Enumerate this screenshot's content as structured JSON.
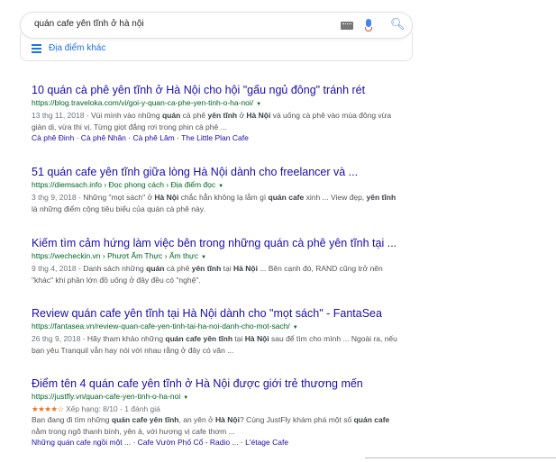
{
  "search": {
    "query": "quán cafe yên tĩnh ở hà nội"
  },
  "places": {
    "label": "Địa điểm khác"
  },
  "results": [
    {
      "title": "10 quán cà phê yên tĩnh ở Hà Nội cho hội \"gấu ngủ đông\" tránh rét",
      "url": "https://blog.traveloka.com/vi/goi-y-quan-ca-phe-yen-tinh-o-ha-noi/",
      "date": "13 thg 11, 2018 - ",
      "snippet_html": "Vùi mình vào những <b>quán</b> cà phê <b>yên tĩnh</b> ở <b>Hà Nội</b> và uống cà phê vào mùa đông vừa giản dị, vừa thi vị. Từng giọt đắng rơi trong phin cà phê ...",
      "links": "Cà phê Đinh · Cà phê Nhân · Cà phê Lâm · The Little Plan Cafe"
    },
    {
      "title": "51 quán cafe yên tĩnh giữa lòng Hà Nội dành cho freelancer và ...",
      "url": "https://diemsach.info › Đọc phong cách › Địa điểm đọc",
      "date": "3 thg 9, 2018 - ",
      "snippet_html": "Những \"mọt sách\" ở <b>Hà Nội</b> chắc hẳn không lạ lẫm gì <b>quán cafe</b> xinh ... View đẹp, <b>yên tĩnh</b> là những điểm cộng tiêu biểu của quán cà phê này."
    },
    {
      "title": "Kiếm tìm cảm hứng làm việc bên trong những quán cà phê yên tĩnh tại ...",
      "url": "https://wecheckin.vn › Phượt Ẩm Thực › Ẩm thực",
      "date": "9 thg 4, 2018 - ",
      "snippet_html": "Danh sách những <b>quán</b> cà phê <b>yên tĩnh</b> tại <b>Hà Nội</b> ... Bên cạnh đó, RAND cũng trở nên \"khác\" khi phần lớn đồ uống ở đây đều có \"nghệ\"."
    },
    {
      "title": "Review quán cafe yên tĩnh tại Hà Nội dành cho \"mọt sách\" - FantaSea",
      "url": "https://fantasea.vn/review-quan-cafe-yen-tinh-tai-ha-noi-danh-cho-mot-sach/",
      "date": "26 thg 9, 2018 - ",
      "snippet_html": "Hãy tham khảo những <b>quán cafe yên tĩnh</b> tại <b>Hà Nội</b> sau để tìm cho mình ... Ngoài ra, nếu bạn yêu Tranquil vẫn hay nói với nhau rằng ở đây có văn ..."
    },
    {
      "title": "Điểm tên 4 quán cafe yên tĩnh ở Hà Nội được giới trẻ thương mến",
      "url": "https://justfly.vn/quan-cafe-yen-tinh-o-ha-noi",
      "stars": "★★★★☆",
      "rating": "Xếp hạng: 8/10 - 1 đánh giá",
      "snippet_html": "Bạn đang đi tìm những <b>quán cafe yên tĩnh</b>, an yên ở <b>Hà Nội</b>? Cùng JustFly khám phá một số <b>quán cafe</b> nằm trong ngõ thanh bình, yên ả, với hương vị cafe thơm ...",
      "links": "Những quán cafe ngồi một ... · Cafe Vườn Phố Cổ - Radio ... · L'étage Cafe"
    }
  ]
}
